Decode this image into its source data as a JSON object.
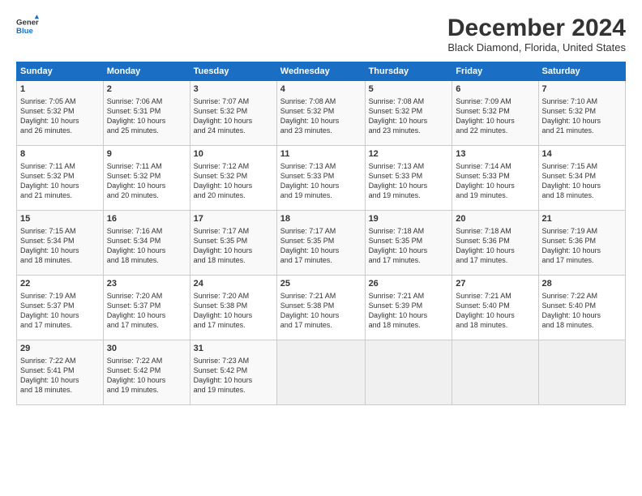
{
  "header": {
    "logo_line1": "General",
    "logo_line2": "Blue",
    "title": "December 2024",
    "subtitle": "Black Diamond, Florida, United States"
  },
  "calendar": {
    "days_of_week": [
      "Sunday",
      "Monday",
      "Tuesday",
      "Wednesday",
      "Thursday",
      "Friday",
      "Saturday"
    ],
    "weeks": [
      [
        {
          "day": "",
          "empty": true
        },
        {
          "day": "",
          "empty": true
        },
        {
          "day": "",
          "empty": true
        },
        {
          "day": "",
          "empty": true
        },
        {
          "day": "",
          "empty": true
        },
        {
          "day": "",
          "empty": true
        },
        {
          "day": "",
          "empty": true
        },
        {
          "day": "1",
          "lines": [
            "Sunrise: 7:05 AM",
            "Sunset: 5:32 PM",
            "Daylight: 10 hours",
            "and 26 minutes."
          ]
        },
        {
          "day": "2",
          "lines": [
            "Sunrise: 7:06 AM",
            "Sunset: 5:31 PM",
            "Daylight: 10 hours",
            "and 25 minutes."
          ]
        },
        {
          "day": "3",
          "lines": [
            "Sunrise: 7:07 AM",
            "Sunset: 5:32 PM",
            "Daylight: 10 hours",
            "and 24 minutes."
          ]
        },
        {
          "day": "4",
          "lines": [
            "Sunrise: 7:08 AM",
            "Sunset: 5:32 PM",
            "Daylight: 10 hours",
            "and 23 minutes."
          ]
        },
        {
          "day": "5",
          "lines": [
            "Sunrise: 7:08 AM",
            "Sunset: 5:32 PM",
            "Daylight: 10 hours",
            "and 23 minutes."
          ]
        },
        {
          "day": "6",
          "lines": [
            "Sunrise: 7:09 AM",
            "Sunset: 5:32 PM",
            "Daylight: 10 hours",
            "and 22 minutes."
          ]
        },
        {
          "day": "7",
          "lines": [
            "Sunrise: 7:10 AM",
            "Sunset: 5:32 PM",
            "Daylight: 10 hours",
            "and 21 minutes."
          ]
        }
      ],
      [
        {
          "day": "8",
          "lines": [
            "Sunrise: 7:11 AM",
            "Sunset: 5:32 PM",
            "Daylight: 10 hours",
            "and 21 minutes."
          ]
        },
        {
          "day": "9",
          "lines": [
            "Sunrise: 7:11 AM",
            "Sunset: 5:32 PM",
            "Daylight: 10 hours",
            "and 20 minutes."
          ]
        },
        {
          "day": "10",
          "lines": [
            "Sunrise: 7:12 AM",
            "Sunset: 5:32 PM",
            "Daylight: 10 hours",
            "and 20 minutes."
          ]
        },
        {
          "day": "11",
          "lines": [
            "Sunrise: 7:13 AM",
            "Sunset: 5:33 PM",
            "Daylight: 10 hours",
            "and 19 minutes."
          ]
        },
        {
          "day": "12",
          "lines": [
            "Sunrise: 7:13 AM",
            "Sunset: 5:33 PM",
            "Daylight: 10 hours",
            "and 19 minutes."
          ]
        },
        {
          "day": "13",
          "lines": [
            "Sunrise: 7:14 AM",
            "Sunset: 5:33 PM",
            "Daylight: 10 hours",
            "and 19 minutes."
          ]
        },
        {
          "day": "14",
          "lines": [
            "Sunrise: 7:15 AM",
            "Sunset: 5:34 PM",
            "Daylight: 10 hours",
            "and 18 minutes."
          ]
        }
      ],
      [
        {
          "day": "15",
          "lines": [
            "Sunrise: 7:15 AM",
            "Sunset: 5:34 PM",
            "Daylight: 10 hours",
            "and 18 minutes."
          ]
        },
        {
          "day": "16",
          "lines": [
            "Sunrise: 7:16 AM",
            "Sunset: 5:34 PM",
            "Daylight: 10 hours",
            "and 18 minutes."
          ]
        },
        {
          "day": "17",
          "lines": [
            "Sunrise: 7:17 AM",
            "Sunset: 5:35 PM",
            "Daylight: 10 hours",
            "and 18 minutes."
          ]
        },
        {
          "day": "18",
          "lines": [
            "Sunrise: 7:17 AM",
            "Sunset: 5:35 PM",
            "Daylight: 10 hours",
            "and 17 minutes."
          ]
        },
        {
          "day": "19",
          "lines": [
            "Sunrise: 7:18 AM",
            "Sunset: 5:35 PM",
            "Daylight: 10 hours",
            "and 17 minutes."
          ]
        },
        {
          "day": "20",
          "lines": [
            "Sunrise: 7:18 AM",
            "Sunset: 5:36 PM",
            "Daylight: 10 hours",
            "and 17 minutes."
          ]
        },
        {
          "day": "21",
          "lines": [
            "Sunrise: 7:19 AM",
            "Sunset: 5:36 PM",
            "Daylight: 10 hours",
            "and 17 minutes."
          ]
        }
      ],
      [
        {
          "day": "22",
          "lines": [
            "Sunrise: 7:19 AM",
            "Sunset: 5:37 PM",
            "Daylight: 10 hours",
            "and 17 minutes."
          ]
        },
        {
          "day": "23",
          "lines": [
            "Sunrise: 7:20 AM",
            "Sunset: 5:37 PM",
            "Daylight: 10 hours",
            "and 17 minutes."
          ]
        },
        {
          "day": "24",
          "lines": [
            "Sunrise: 7:20 AM",
            "Sunset: 5:38 PM",
            "Daylight: 10 hours",
            "and 17 minutes."
          ]
        },
        {
          "day": "25",
          "lines": [
            "Sunrise: 7:21 AM",
            "Sunset: 5:38 PM",
            "Daylight: 10 hours",
            "and 17 minutes."
          ]
        },
        {
          "day": "26",
          "lines": [
            "Sunrise: 7:21 AM",
            "Sunset: 5:39 PM",
            "Daylight: 10 hours",
            "and 18 minutes."
          ]
        },
        {
          "day": "27",
          "lines": [
            "Sunrise: 7:21 AM",
            "Sunset: 5:40 PM",
            "Daylight: 10 hours",
            "and 18 minutes."
          ]
        },
        {
          "day": "28",
          "lines": [
            "Sunrise: 7:22 AM",
            "Sunset: 5:40 PM",
            "Daylight: 10 hours",
            "and 18 minutes."
          ]
        }
      ],
      [
        {
          "day": "29",
          "lines": [
            "Sunrise: 7:22 AM",
            "Sunset: 5:41 PM",
            "Daylight: 10 hours",
            "and 18 minutes."
          ]
        },
        {
          "day": "30",
          "lines": [
            "Sunrise: 7:22 AM",
            "Sunset: 5:42 PM",
            "Daylight: 10 hours",
            "and 19 minutes."
          ]
        },
        {
          "day": "31",
          "lines": [
            "Sunrise: 7:23 AM",
            "Sunset: 5:42 PM",
            "Daylight: 10 hours",
            "and 19 minutes."
          ]
        },
        {
          "day": "",
          "empty": true
        },
        {
          "day": "",
          "empty": true
        },
        {
          "day": "",
          "empty": true
        },
        {
          "day": "",
          "empty": true
        }
      ]
    ]
  }
}
